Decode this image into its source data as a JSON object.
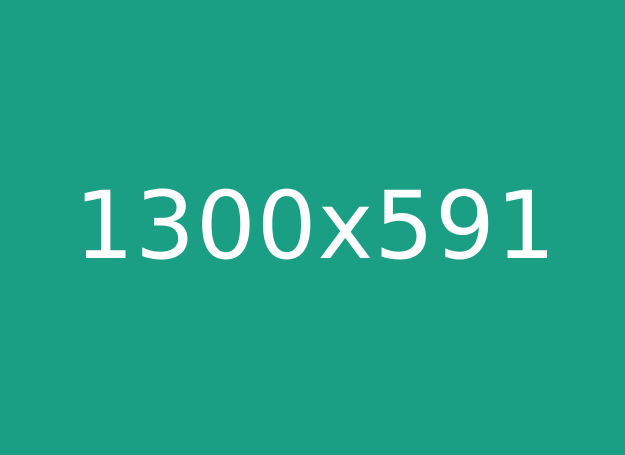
{
  "placeholder": {
    "label": "1300x591",
    "background_color": "#1a9e84",
    "text_color": "#ffffff"
  }
}
